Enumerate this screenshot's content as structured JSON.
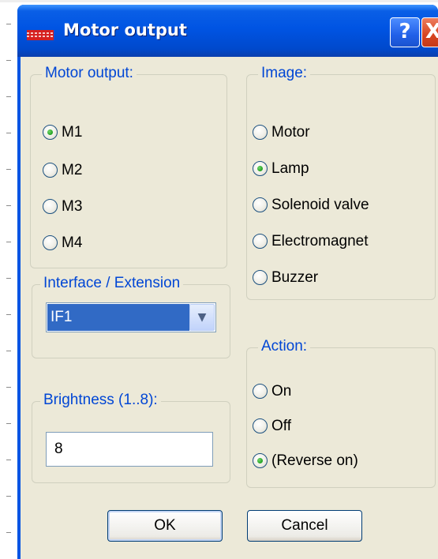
{
  "window": {
    "title": "Motor output",
    "help_label": "?",
    "close_label": "X"
  },
  "motor_output": {
    "legend": "Motor output:",
    "options": [
      "M1",
      "M2",
      "M3",
      "M4"
    ],
    "selected": "M1"
  },
  "image": {
    "legend": "Image:",
    "options": [
      "Motor",
      "Lamp",
      "Solenoid valve",
      "Electromagnet",
      "Buzzer"
    ],
    "selected": "Lamp"
  },
  "interface": {
    "legend": "Interface / Extension",
    "value": "IF1"
  },
  "action": {
    "legend": "Action:",
    "options": [
      "On",
      "Off",
      "(Reverse on)"
    ],
    "selected": "(Reverse on)"
  },
  "brightness": {
    "legend": "Brightness (1..8):",
    "value": "8"
  },
  "buttons": {
    "ok": "OK",
    "cancel": "Cancel"
  }
}
